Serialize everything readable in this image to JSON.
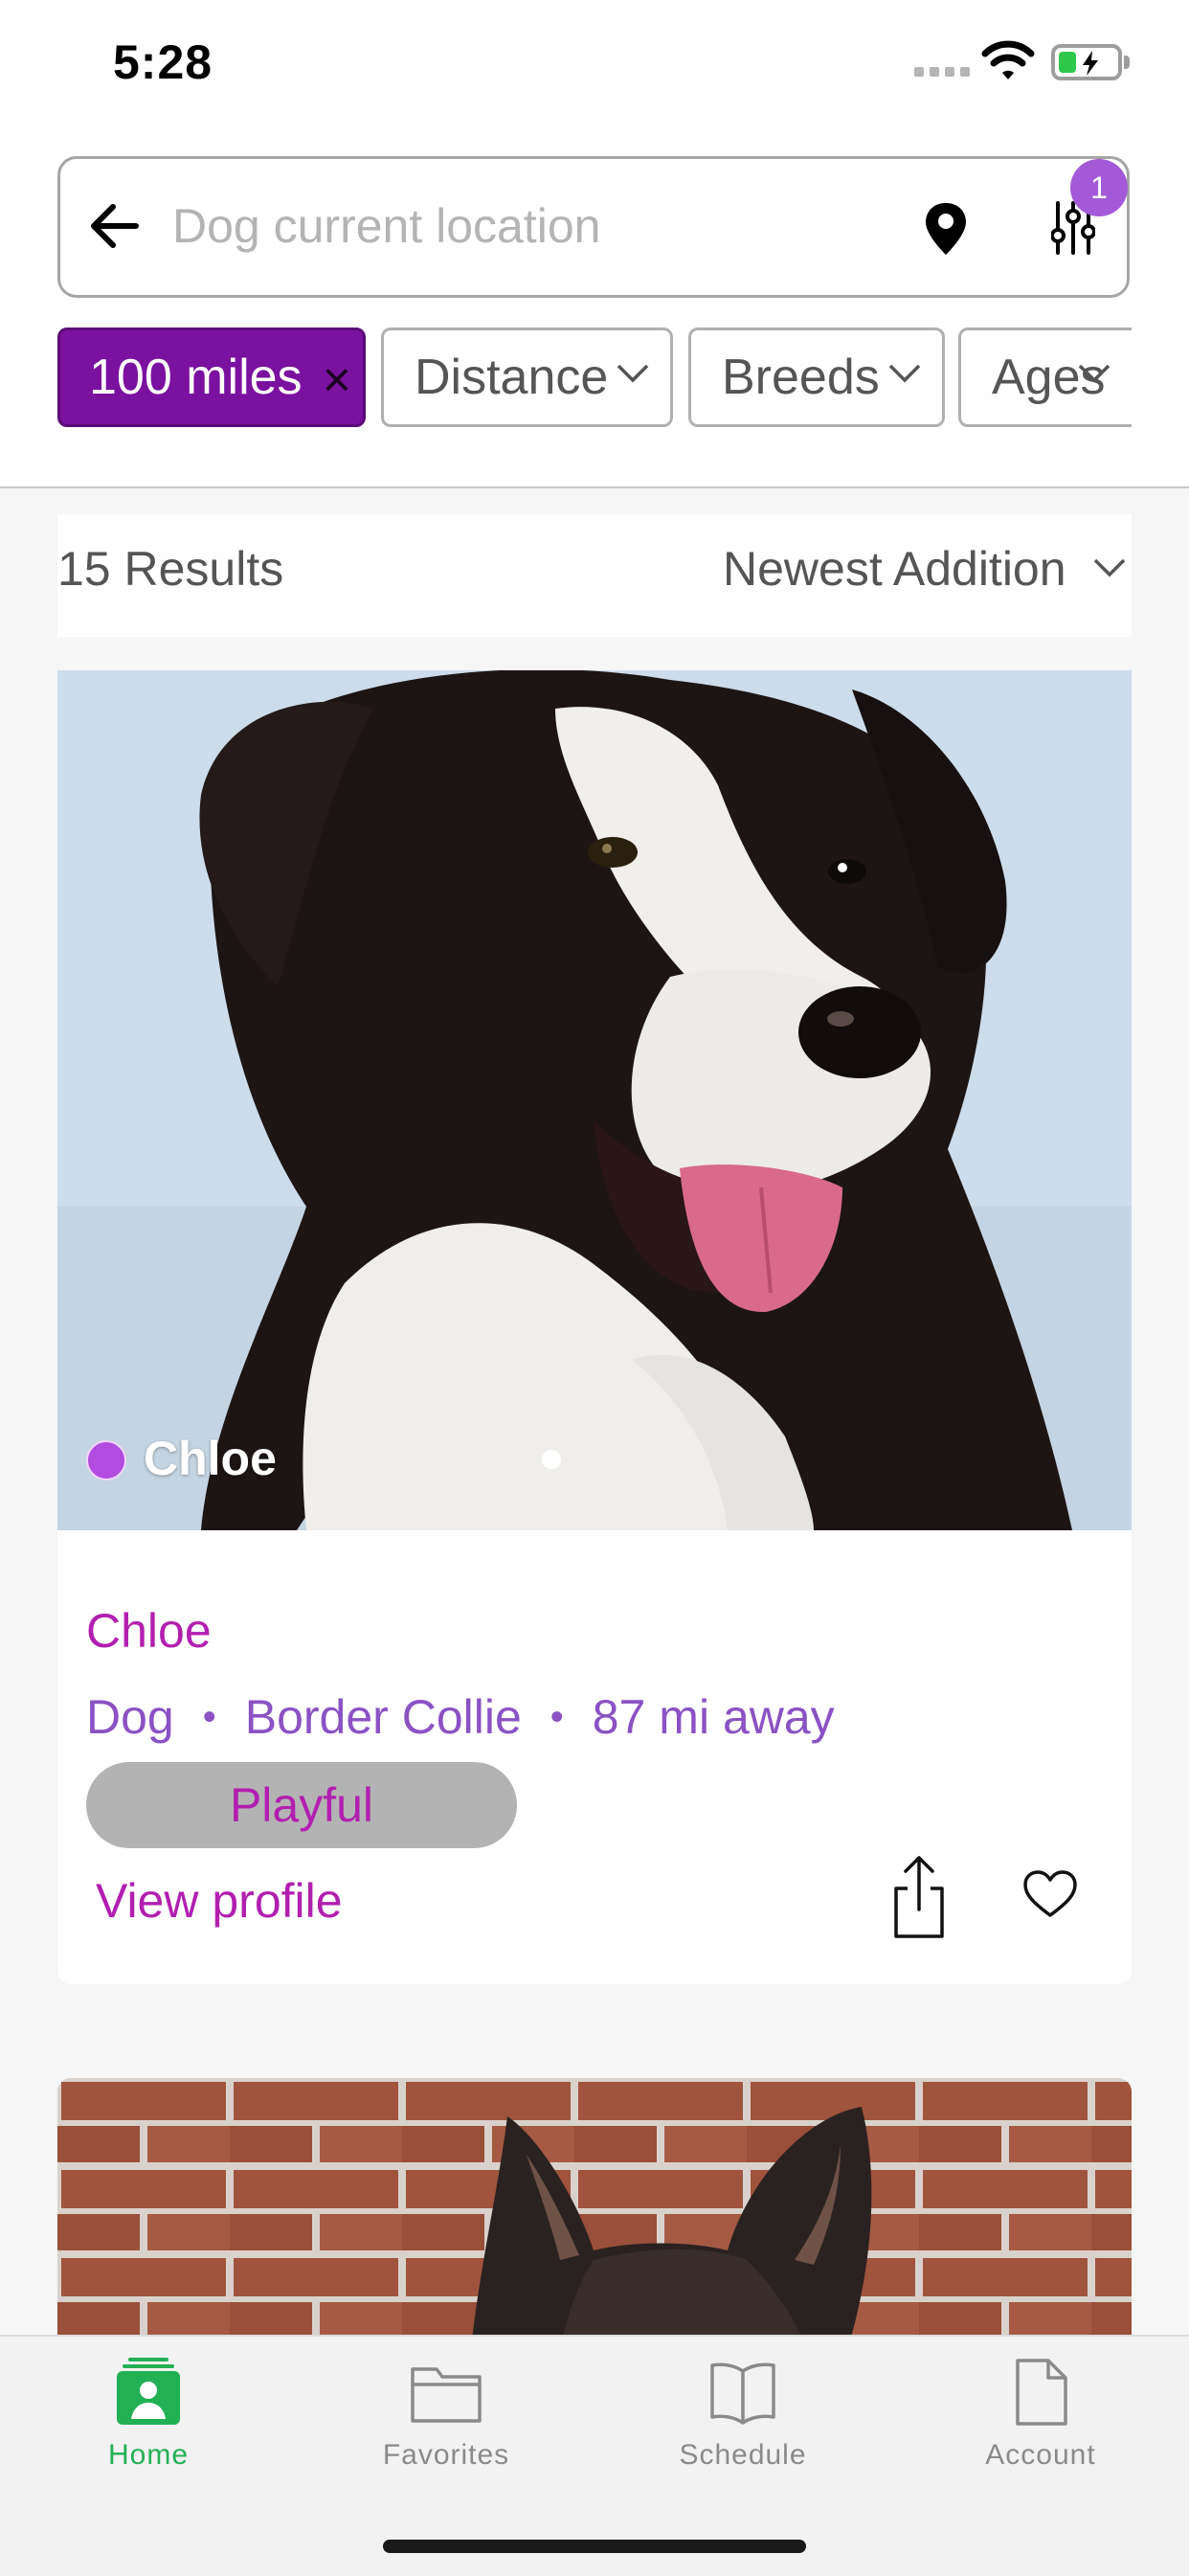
{
  "status_bar": {
    "time": "5:28"
  },
  "search": {
    "placeholder": "Dog current location",
    "filter_badge_count": "1"
  },
  "chips": [
    {
      "label": "100 miles",
      "active": true,
      "close": "×"
    },
    {
      "label": "Distance",
      "active": false
    },
    {
      "label": "Breeds",
      "active": false
    },
    {
      "label": "Ages",
      "active": false
    }
  ],
  "results": {
    "count_label": "15 Results",
    "sort_label": "Newest Addition"
  },
  "pet_card": {
    "overlay_name": "Chloe",
    "name": "Chloe",
    "species": "Dog",
    "breed": "Border Collie",
    "distance": "87 mi away",
    "separator": "•",
    "trait": "Playful",
    "view_profile": "View profile"
  },
  "tabs": [
    {
      "label": "Home",
      "icon": "home-icon",
      "active": true
    },
    {
      "label": "Favorites",
      "icon": "folder-icon",
      "active": false
    },
    {
      "label": "Schedule",
      "icon": "book-icon",
      "active": false
    },
    {
      "label": "Account",
      "icon": "document-icon",
      "active": false
    }
  ],
  "colors": {
    "accent_purple": "#7b119f",
    "text_magenta": "#b21fb0",
    "meta_purple": "#8a52c4",
    "tab_active_green": "#22b055",
    "badge_purple": "#a45ad8"
  }
}
